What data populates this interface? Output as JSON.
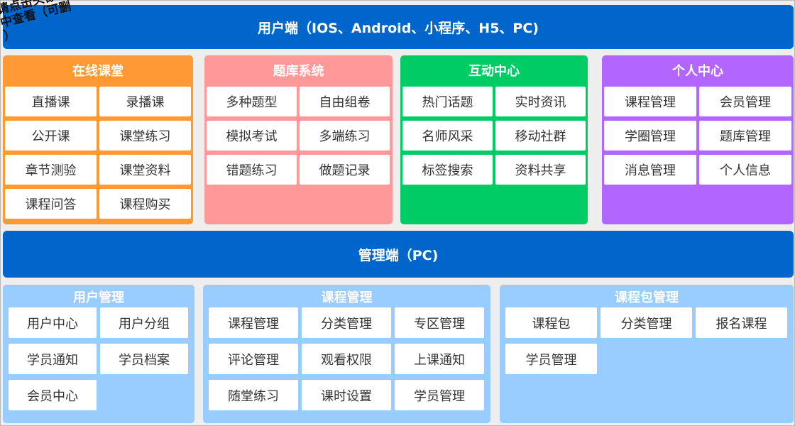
{
  "note": "请点击头像\n中查看（可删\n）",
  "user_side": {
    "title": "用户端（IOS、Android、小程序、H5、PC)",
    "panels": [
      {
        "title": "在线课堂",
        "color": "#ff9933",
        "items": [
          "直播课",
          "录播课",
          "公开课",
          "课堂练习",
          "章节测验",
          "课堂资料",
          "课程问答",
          "课程购买"
        ]
      },
      {
        "title": "题库系统",
        "color": "#ff9999",
        "items": [
          "多种题型",
          "自由组卷",
          "模拟考试",
          "多端练习",
          "错题练习",
          "做题记录"
        ]
      },
      {
        "title": "互动中心",
        "color": "#00cc66",
        "items": [
          "热门话题",
          "实时资讯",
          "名师风采",
          "移动社群",
          "标签搜索",
          "资料共享"
        ]
      },
      {
        "title": "个人中心",
        "color": "#b366ff",
        "items": [
          "课程管理",
          "会员管理",
          "学圈管理",
          "题库管理",
          "消息管理",
          "个人信息"
        ]
      }
    ]
  },
  "admin_side": {
    "title": "管理端（PC)",
    "panel_color": "#99ccff",
    "panels": [
      {
        "title": "用户管理",
        "items": [
          "用户中心",
          "用户分组",
          "学员通知",
          "学员档案",
          "会员中心"
        ]
      },
      {
        "title": "课程管理",
        "items": [
          "课程管理",
          "分类管理",
          "专区管理",
          "评论管理",
          "观看权限",
          "上课通知",
          "随堂练习",
          "课时设置",
          "学员管理"
        ]
      },
      {
        "title": "课程包管理",
        "items": [
          "课程包",
          "分类管理",
          "报名课程",
          "学员管理"
        ]
      }
    ]
  }
}
